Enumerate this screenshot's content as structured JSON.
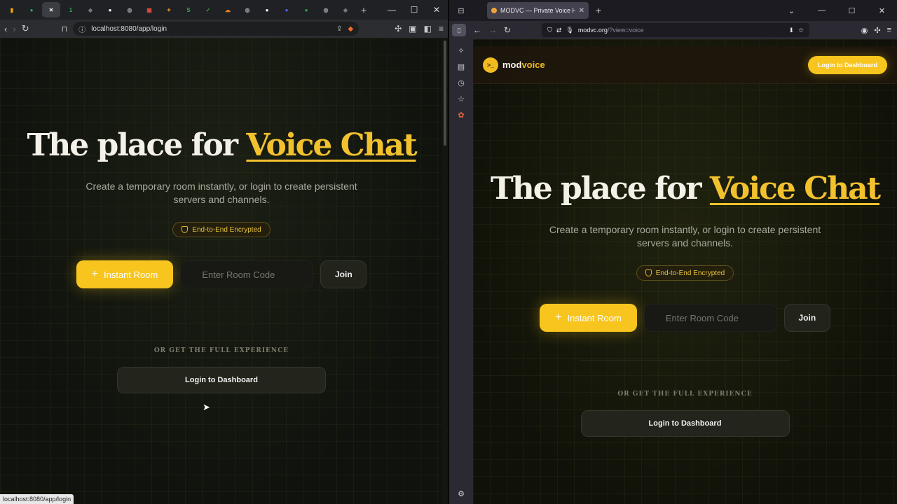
{
  "left_window": {
    "tabs": [
      {
        "icon": "analytics-icon",
        "color": "#f9ab00",
        "glyph": "▮"
      },
      {
        "icon": "chrome-icon",
        "color": "#34a853",
        "glyph": "●"
      },
      {
        "icon": "close-icon",
        "color": "#ffffff",
        "glyph": "✕",
        "active": true
      },
      {
        "icon": "number-badge-icon",
        "color": "#2bb04a",
        "glyph": "1"
      },
      {
        "icon": "shield-icon",
        "color": "#777777",
        "glyph": "◆"
      },
      {
        "icon": "github-icon",
        "color": "#ffffff",
        "glyph": "●"
      },
      {
        "icon": "globe-icon",
        "color": "#999999",
        "glyph": "◍"
      },
      {
        "icon": "calendar-icon",
        "color": "#e04a3f",
        "glyph": "▦"
      },
      {
        "icon": "butterfly-icon",
        "color": "#e08a2b",
        "glyph": "✦"
      },
      {
        "icon": "s-icon",
        "color": "#2bb04a",
        "glyph": "S"
      },
      {
        "icon": "check-icon",
        "color": "#2bb04a",
        "glyph": "✓"
      },
      {
        "icon": "cloud-icon",
        "color": "#f38020",
        "glyph": "☁"
      },
      {
        "icon": "globe-icon",
        "color": "#999999",
        "glyph": "◍"
      },
      {
        "icon": "github-icon",
        "color": "#ffffff",
        "glyph": "●"
      },
      {
        "icon": "discord-icon",
        "color": "#5865f2",
        "glyph": "●"
      },
      {
        "icon": "chrome-icon",
        "color": "#34a853",
        "glyph": "●"
      },
      {
        "icon": "globe-icon",
        "color": "#999999",
        "glyph": "◍"
      },
      {
        "icon": "shield-icon",
        "color": "#777777",
        "glyph": "◆"
      }
    ],
    "url": "localhost:8080/app/login",
    "status_url": "localhost:8080/app/login"
  },
  "right_window": {
    "tab_title": "MODVC — Private Voice Hub &",
    "url_host": "modvc.org",
    "url_path": "/?view=voice"
  },
  "site": {
    "logo_mod": "mod",
    "logo_voice": "voice",
    "logo_mark": ">_",
    "nav_login": "Login to Dashboard",
    "headline_start": "The place for ",
    "headline_highlight": "Voice Chat",
    "subtitle": "Create a temporary room instantly, or login to create persistent servers and channels.",
    "badge": "End-to-End Encrypted",
    "instant_room": "Instant Room",
    "room_code_placeholder": "Enter Room Code",
    "join": "Join",
    "or_label": "OR GET THE FULL EXPERIENCE",
    "dashboard_button": "Login to Dashboard"
  },
  "colors": {
    "accent": "#f7c51d",
    "headline": "#f4f1e8",
    "badge_text": "#e7c23c"
  }
}
